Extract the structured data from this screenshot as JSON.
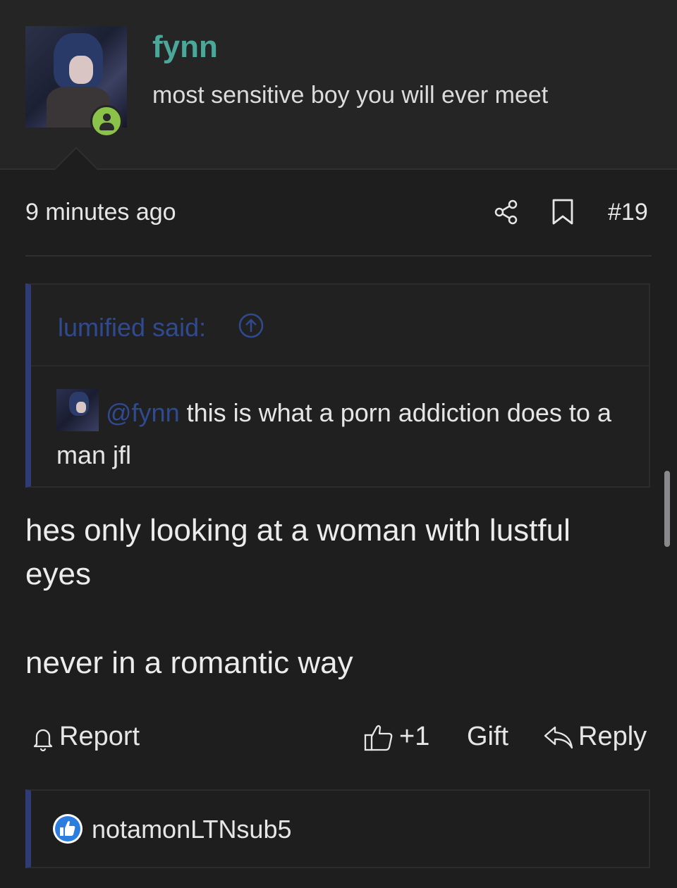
{
  "post": {
    "author": "fynn",
    "author_title": "most sensitive boy you will ever meet",
    "timestamp": "9 minutes ago",
    "post_number": "#19"
  },
  "quote": {
    "author_label": "lumified said:",
    "mention": "@fynn",
    "text": " this is what a porn addiction does to a man jfl"
  },
  "body": {
    "paragraphs": [
      "hes only looking at a woman with lustful eyes",
      "never in a romantic way"
    ]
  },
  "actions": {
    "report": "Report",
    "like": "+1",
    "gift": "Gift",
    "reply": "Reply"
  },
  "reactions": {
    "users": "notamonLTNsub5"
  },
  "colors": {
    "accent_username": "#4aa89a",
    "quote_bar": "#2f3b75",
    "online": "#8bc34a"
  },
  "icons": [
    "share-icon",
    "bookmark-icon",
    "arrow-up-circle-icon",
    "bell-icon",
    "thumbs-up-icon",
    "reply-icon",
    "like-reaction-icon",
    "user-online-icon"
  ]
}
